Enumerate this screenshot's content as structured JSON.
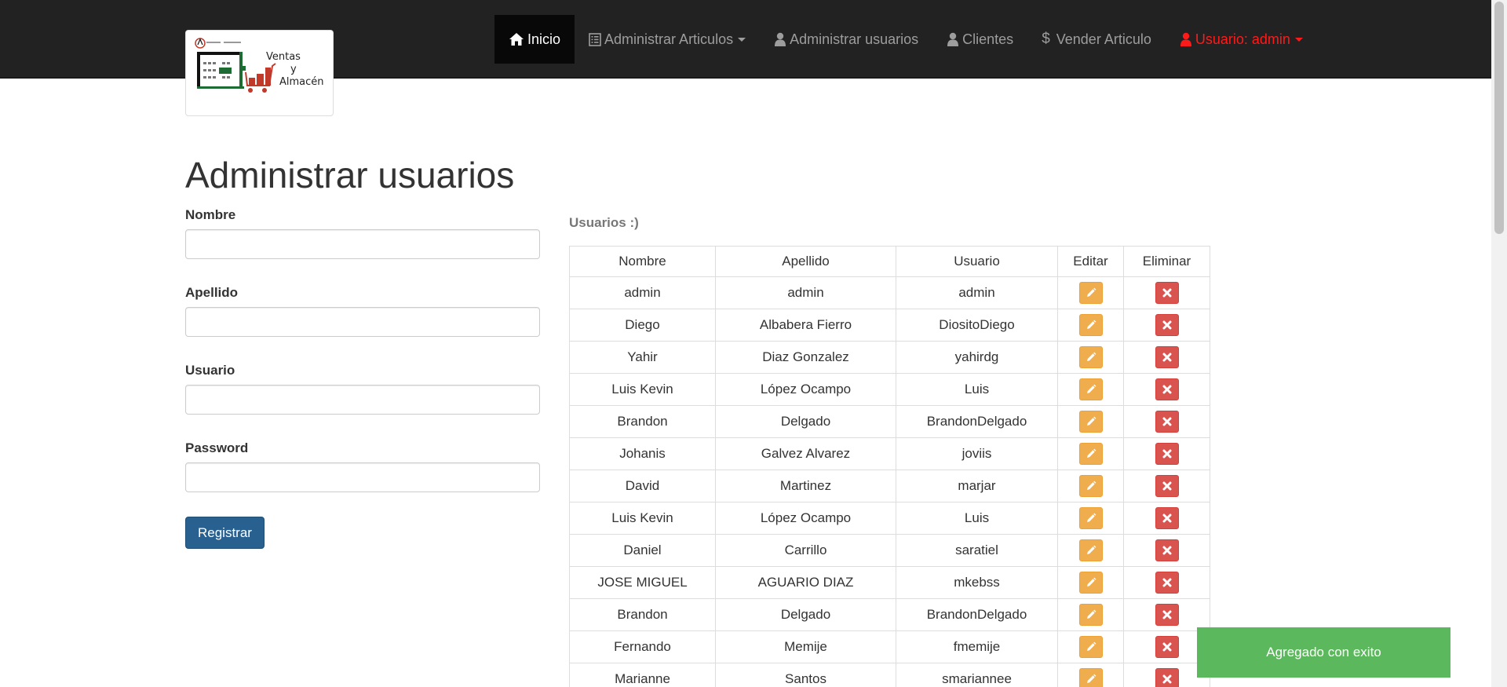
{
  "colors": {
    "navbar": "#222222",
    "active_nav": "#080808",
    "user_nav": "#ff1a1a",
    "primary": "#286090",
    "warning": "#f0ad4e",
    "danger": "#d9534f",
    "success": "#5cb85c"
  },
  "nav": {
    "inicio": "Inicio",
    "articulos": "Administrar Articulos",
    "usuarios": "Administrar usuarios",
    "clientes": "Clientes",
    "vender": "Vender Articulo",
    "user": "Usuario: admin"
  },
  "logo": {
    "line1": "Ventas",
    "line2": "y",
    "line3": "Almacén"
  },
  "page": {
    "title": "Administrar usuarios"
  },
  "form": {
    "nombre_label": "Nombre",
    "apellido_label": "Apellido",
    "usuario_label": "Usuario",
    "password_label": "Password",
    "submit": "Registrar"
  },
  "table": {
    "caption": "Usuarios :)",
    "headers": [
      "Nombre",
      "Apellido",
      "Usuario",
      "Editar",
      "Eliminar"
    ],
    "rows": [
      [
        "admin",
        "admin",
        "admin"
      ],
      [
        "Diego",
        "Albabera Fierro",
        "DiositoDiego"
      ],
      [
        "Yahir",
        "Diaz Gonzalez",
        "yahirdg"
      ],
      [
        "Luis Kevin",
        "López Ocampo",
        "Luis"
      ],
      [
        "Brandon",
        "Delgado",
        "BrandonDelgado"
      ],
      [
        "Johanis",
        "Galvez Alvarez",
        "joviis"
      ],
      [
        "David",
        "Martinez",
        "marjar"
      ],
      [
        "Luis Kevin",
        "López Ocampo",
        "Luis"
      ],
      [
        "Daniel",
        "Carrillo",
        "saratiel"
      ],
      [
        "JOSE MIGUEL",
        "AGUARIO DIAZ",
        "mkebss"
      ],
      [
        "Brandon",
        "Delgado",
        "BrandonDelgado"
      ],
      [
        "Fernando",
        "Memije",
        "fmemije"
      ],
      [
        "Marianne",
        "Santos",
        "smariannee"
      ]
    ]
  },
  "toast": {
    "message": "Agregado con exito"
  }
}
